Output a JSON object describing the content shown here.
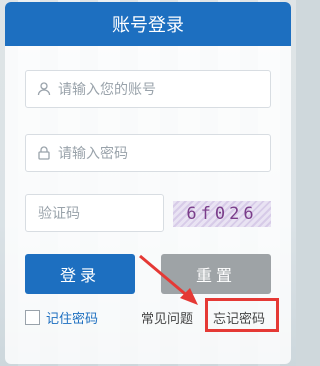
{
  "header": {
    "title": "账号登录"
  },
  "form": {
    "account_placeholder": "请输入您的账号",
    "password_placeholder": "请输入密码",
    "captcha_placeholder": "验证码",
    "captcha_text": "6f026"
  },
  "buttons": {
    "login": "登录",
    "reset": "重置"
  },
  "links": {
    "remember": "记住密码",
    "faq": "常见问题",
    "forgot": "忘记密码"
  },
  "colors": {
    "brand": "#1d6fc0",
    "reset": "#9ea3a6",
    "annotation": "#e53935"
  }
}
